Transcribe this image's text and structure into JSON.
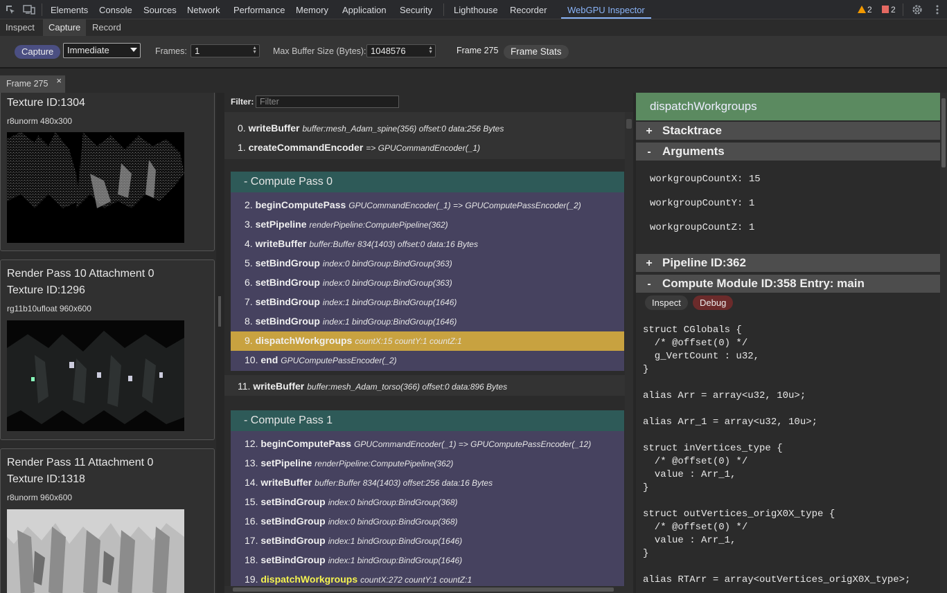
{
  "devtools": {
    "tabs": [
      "Elements",
      "Console",
      "Sources",
      "Network",
      "Performance",
      "Memory",
      "Application",
      "Security",
      "Lighthouse",
      "Recorder",
      "WebGPU Inspector"
    ],
    "active_tab": "WebGPU Inspector",
    "warnings_count": "2",
    "errors_count": "2",
    "icons": [
      "inspect-element-icon",
      "device-toolbar-icon",
      "settings-gear-icon",
      "more-vertical-icon"
    ]
  },
  "subtabs": [
    "Inspect",
    "Capture",
    "Record"
  ],
  "active_subtab": "Capture",
  "toolbar": {
    "capture_label": "Capture",
    "mode_value": "Immediate",
    "frames_label": "Frames:",
    "frames_value": "1",
    "maxbuf_label": "Max Buffer Size (Bytes):",
    "maxbuf_value": "1048576",
    "frame_label": "Frame 275",
    "frame_stats_label": "Frame Stats"
  },
  "frame_tab": {
    "label": "Frame 275",
    "close": "×"
  },
  "textures": [
    {
      "title": "",
      "id": "Texture ID:1304",
      "format": "r8unorm 480x300"
    },
    {
      "title": "Render Pass 10 Attachment 0",
      "id": "Texture ID:1296",
      "format": "rg11b10ufloat 960x600"
    },
    {
      "title": "Render Pass 11 Attachment 0",
      "id": "Texture ID:1318",
      "format": "r8unorm 960x600"
    }
  ],
  "filter": {
    "label": "Filter:",
    "placeholder": "Filter"
  },
  "commands_top": [
    {
      "n": "0.",
      "name": "writeBuffer",
      "args": "buffer:mesh_Adam_spine(356) offset:0 data:256 Bytes"
    },
    {
      "n": "1.",
      "name": "createCommandEncoder",
      "args": "=> GPUCommandEncoder(_1)"
    }
  ],
  "pass0": {
    "title": "-  Compute Pass 0",
    "commands": [
      {
        "n": "2.",
        "name": "beginComputePass",
        "args": "GPUCommandEncoder(_1) => GPUComputePassEncoder(_2)"
      },
      {
        "n": "3.",
        "name": "setPipeline",
        "args": "renderPipeline:ComputePipeline(362)"
      },
      {
        "n": "4.",
        "name": "writeBuffer",
        "args": "buffer:Buffer 834(1403) offset:0 data:16 Bytes"
      },
      {
        "n": "5.",
        "name": "setBindGroup",
        "args": "index:0 bindGroup:BindGroup(363)"
      },
      {
        "n": "6.",
        "name": "setBindGroup",
        "args": "index:0 bindGroup:BindGroup(363)"
      },
      {
        "n": "7.",
        "name": "setBindGroup",
        "args": "index:1 bindGroup:BindGroup(1646)"
      },
      {
        "n": "8.",
        "name": "setBindGroup",
        "args": "index:1 bindGroup:BindGroup(1646)"
      },
      {
        "n": "9.",
        "name": "dispatchWorkgroups",
        "args": "countX:15 countY:1 countZ:1"
      },
      {
        "n": "10.",
        "name": "end",
        "args": "GPUComputePassEncoder(_2)"
      }
    ]
  },
  "command_mid": {
    "n": "11.",
    "name": "writeBuffer",
    "args": "buffer:mesh_Adam_torso(366) offset:0 data:896 Bytes"
  },
  "pass1": {
    "title": "-  Compute Pass 1",
    "commands": [
      {
        "n": "12.",
        "name": "beginComputePass",
        "args": "GPUCommandEncoder(_1) => GPUComputePassEncoder(_12)"
      },
      {
        "n": "13.",
        "name": "setPipeline",
        "args": "renderPipeline:ComputePipeline(362)"
      },
      {
        "n": "14.",
        "name": "writeBuffer",
        "args": "buffer:Buffer 834(1403) offset:256 data:16 Bytes"
      },
      {
        "n": "15.",
        "name": "setBindGroup",
        "args": "index:0 bindGroup:BindGroup(368)"
      },
      {
        "n": "16.",
        "name": "setBindGroup",
        "args": "index:0 bindGroup:BindGroup(368)"
      },
      {
        "n": "17.",
        "name": "setBindGroup",
        "args": "index:1 bindGroup:BindGroup(1646)"
      },
      {
        "n": "18.",
        "name": "setBindGroup",
        "args": "index:1 bindGroup:BindGroup(1646)"
      },
      {
        "n": "19.",
        "name": "dispatchWorkgroups",
        "args": "countX:272 countY:1 countZ:1"
      }
    ]
  },
  "details": {
    "title": "dispatchWorkgroups",
    "stacktrace": "Stacktrace",
    "arguments": "Arguments",
    "args": [
      "workgroupCountX: 15",
      "workgroupCountY: 1",
      "workgroupCountZ: 1"
    ],
    "pipeline": "Pipeline ID:362",
    "module": "Compute Module ID:358 Entry: main",
    "inspect_label": "Inspect",
    "debug_label": "Debug",
    "plus": "+",
    "minus": "-",
    "code": "struct CGlobals {\n  /* @offset(0) */\n  g_VertCount : u32,\n}\n\nalias Arr = array<u32, 10u>;\n\nalias Arr_1 = array<u32, 10u>;\n\nstruct inVertices_type {\n  /* @offset(0) */\n  value : Arr_1,\n}\n\nstruct outVertices_origX0X_type {\n  /* @offset(0) */\n  value : Arr_1,\n}\n\nalias RTArr = array<outVertices_origX0X_type>;"
  },
  "colors": {
    "accent": "#8ab4f8",
    "pass_header": "#2e5a58",
    "pass_body": "#46425f",
    "selected": "#c8a240",
    "details_header": "#5b8a60"
  }
}
